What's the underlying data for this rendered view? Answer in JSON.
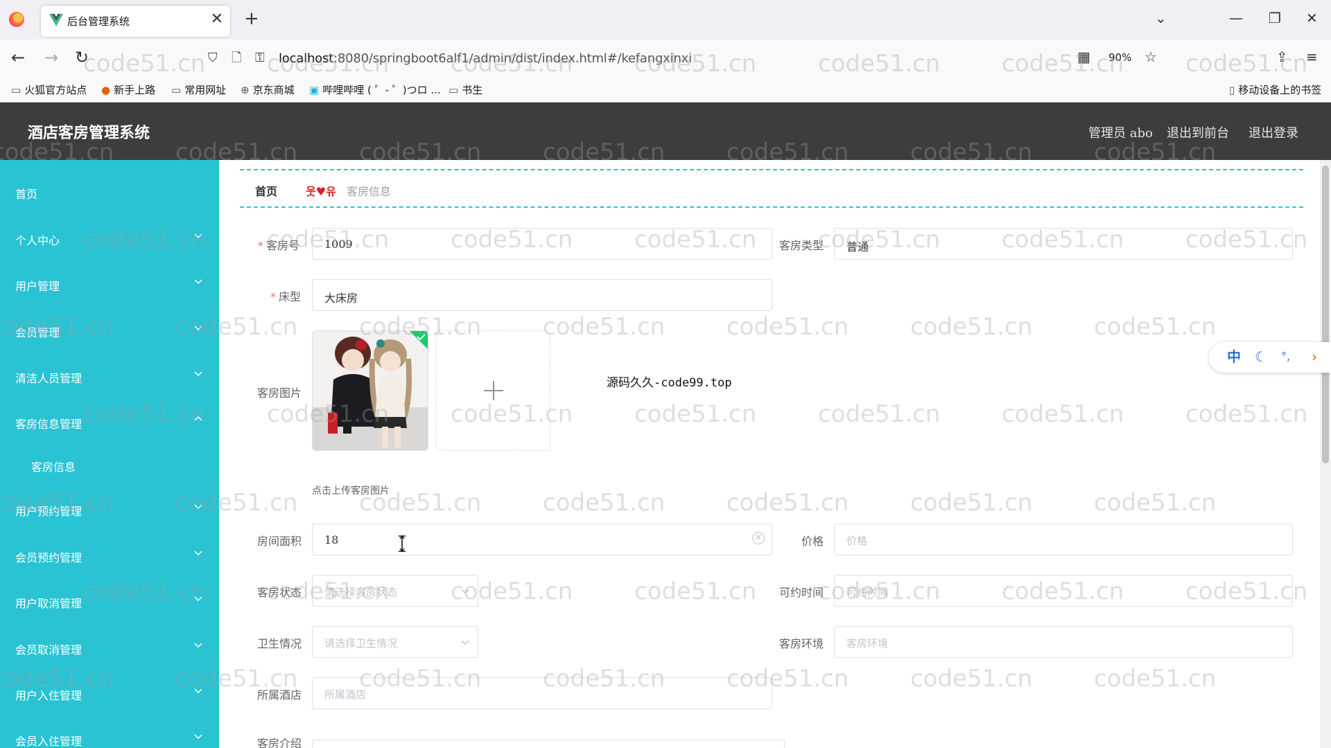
{
  "browser": {
    "tab_title": "后台管理系统",
    "new_tab": "+",
    "close_tab": "✕",
    "url_host": "localhost",
    "url_rest": ":8080/springboot6alf1/admin/dist/index.html#/kefangxinxi",
    "zoom": "90%",
    "bookmarks": [
      "火狐官方站点",
      "新手上路",
      "常用网址",
      "京东商城",
      "哔哩哔哩 ( ゜- ゜)つロ ...",
      "书生"
    ],
    "mobile_bookmarks": "移动设备上的书签"
  },
  "header": {
    "title": "酒店客房管理系统",
    "admin": "管理员 abo",
    "to_front": "退出到前台",
    "logout": "退出登录"
  },
  "sidebar": {
    "items": [
      {
        "label": "首页",
        "arrow": "none"
      },
      {
        "label": "个人中心",
        "arrow": "down"
      },
      {
        "label": "用户管理",
        "arrow": "down"
      },
      {
        "label": "会员管理",
        "arrow": "down"
      },
      {
        "label": "清洁人员管理",
        "arrow": "down"
      },
      {
        "label": "客房信息管理",
        "arrow": "up"
      },
      {
        "label": "客房信息",
        "arrow": "none",
        "sub": true
      },
      {
        "label": "用户预约管理",
        "arrow": "down"
      },
      {
        "label": "会员预约管理",
        "arrow": "down"
      },
      {
        "label": "用户取消管理",
        "arrow": "down"
      },
      {
        "label": "会员取消管理",
        "arrow": "down"
      },
      {
        "label": "用户入住管理",
        "arrow": "down"
      },
      {
        "label": "会员入住管理",
        "arrow": "down"
      }
    ]
  },
  "breadcrumb": {
    "home": "首页",
    "separator": "웃♥유",
    "current": "客房信息"
  },
  "form": {
    "room_no": {
      "label": "客房号",
      "value": "1009"
    },
    "room_type": {
      "label": "客房类型",
      "value": "普通"
    },
    "bed_type": {
      "label": "床型",
      "value": "大床房"
    },
    "room_image": {
      "label": "客房图片",
      "tip": "点击上传客房图片"
    },
    "area": {
      "label": "房间面积",
      "value": "18"
    },
    "price": {
      "label": "价格",
      "placeholder": "价格"
    },
    "room_status": {
      "label": "客房状态",
      "placeholder": "请选择客房状态"
    },
    "bookable_time": {
      "label": "可约时间",
      "placeholder": "可约时间"
    },
    "hygiene": {
      "label": "卫生情况",
      "placeholder": "请选择卫生情况"
    },
    "environment": {
      "label": "客房环境",
      "placeholder": "客房环境"
    },
    "hotel": {
      "label": "所属酒店",
      "placeholder": "所属酒店"
    },
    "intro": {
      "label": "客房介绍"
    }
  },
  "overlay_text": "源码久久-code99.top",
  "ime": {
    "lang": "中"
  },
  "watermark": "code51.cn",
  "colors": {
    "sidebar": "#2ac3d3",
    "header": "#3d3d3d",
    "required": "#f56c6c",
    "breadcrumb_sep": "#e02020"
  }
}
